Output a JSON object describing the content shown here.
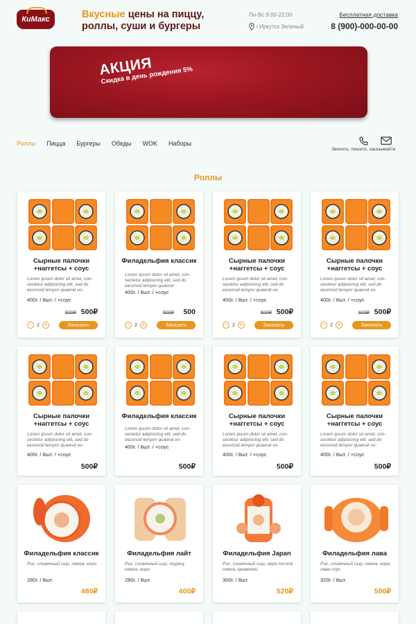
{
  "brand": {
    "logo_text": "КиМакс"
  },
  "header": {
    "tagline_accent": "Вкусные",
    "tagline_rest": " цены на пиццу, роллы, суши и бургеры",
    "hours": "Пн-Вс 9:00-22:00",
    "city": "г.Иркутск Зеленый",
    "delivery": "Бесплатная доставка",
    "phone": "8 (900)-000-00-00"
  },
  "banner": {
    "title": "АКЦИЯ",
    "subtitle": "Скидка в день рождения 5%"
  },
  "nav": {
    "items": [
      "Роллы",
      "Пицца",
      "Бургеры",
      "Обеды",
      "WOK",
      "Наборы"
    ],
    "active": "Роллы"
  },
  "contact": {
    "caption": "Звоните, пишите, заказывайте"
  },
  "section": {
    "title": "Роллы"
  },
  "products": [
    {
      "name": "Сырные палочки +наггетсы + соус",
      "desc": "Lorem ipsum dolor sit amet, con-sectetur adipisicing elit, sed do eiusmod tempor quaerat vo-",
      "meta": "400г. / 8шт. / +соус",
      "old": "600₽",
      "price": "500₽",
      "qty": "2",
      "order": "Заказать",
      "img": "square"
    },
    {
      "name": "Филадельфия классик",
      "desc": "Lorem ipsum dolor sit amet, con-sectetur adipisicing elit, sed do eiusmod tempor quaerat",
      "meta": "400г. / 8шт. / +соус",
      "old": "500₽",
      "price": "500",
      "qty": "2",
      "order": "Заказать",
      "img": "square"
    },
    {
      "name": "Сырные палочки +наггетсы + соус",
      "desc": "Lorem ipsum dolor sit amet, con-sectetur adipisicing elit, sed do eiusmod tempor quaerat vo-",
      "meta": "400г. / 8шт. / +соус",
      "old": "600₽",
      "price": "500₽",
      "qty": "2",
      "order": "Заказать",
      "img": "square"
    },
    {
      "name": "Сырные палочки +наггетсы + соус",
      "desc": "Lorem ipsum dolor sit amet, con-sectetur adipisicing elit, sed do eiusmod tempor quaerat vo-",
      "meta": "400г. / 8шт. / +соус",
      "old": "600₽",
      "price": "500₽",
      "qty": "2",
      "order": "Заказать",
      "img": "square"
    },
    {
      "name": "Сырные палочки +наггетсы + соус",
      "desc": "Lorem ipsum dolor sit amet, con-sectetur adipisicing elit, sed do eiusmod tempor quaerat vo-",
      "meta": "400г. / 8шт. / +соус",
      "price": "500₽",
      "img": "square"
    },
    {
      "name": "Филадельфия классик",
      "desc": "Lorem ipsum dolor sit amet, con-sectetur adipisicing elit, sed do eiusmod tempor quaerat vo-",
      "meta": "400г. / 8шт. / +соус",
      "price": "500₽",
      "img": "square"
    },
    {
      "name": "Сырные палочки +наггетсы + соус",
      "desc": "Lorem ipsum dolor sit amet, con-sectetur adipisicing elit, sed do eiusmod tempor quaerat vo-",
      "meta": "400г. / 8шт. / +соус",
      "price": "500₽",
      "img": "square"
    },
    {
      "name": "Сырные палочки +наггетсы + соус",
      "desc": "Lorem ipsum dolor sit amet, con-sectetur adipisicing elit, sed do eiusmod tempor quaerat vo-",
      "meta": "400г. / 8шт. / +соус",
      "price": "500₽",
      "img": "square"
    },
    {
      "name": "Филадельфия классик",
      "desc": "Рис, сливочный сыр, семга, нори",
      "meta": "280г. / 8шт.",
      "price": "480₽",
      "img": "roll-a"
    },
    {
      "name": "Филадельфия лайт",
      "desc": "Рис, сливочный сыр, огурец, семга, нори",
      "meta": "280г. / 8шт.",
      "price": "400₽",
      "img": "roll-b"
    },
    {
      "name": "Филадельфия Japan",
      "desc": "Рис, сливочный сыр, икра лосося, семга, креветки",
      "meta": "300г. / 8шт.",
      "price": "520₽",
      "img": "roll-c"
    },
    {
      "name": "Филадельфия лава",
      "desc": "Рис, сливочный сыр, семга, нори, лава соус",
      "meta": "320г. / 8шт.",
      "price": "500₽",
      "img": "roll-d"
    }
  ],
  "colors": {
    "accent": "#e8961e",
    "brand": "#8a1016",
    "banner": "#9e1722"
  }
}
